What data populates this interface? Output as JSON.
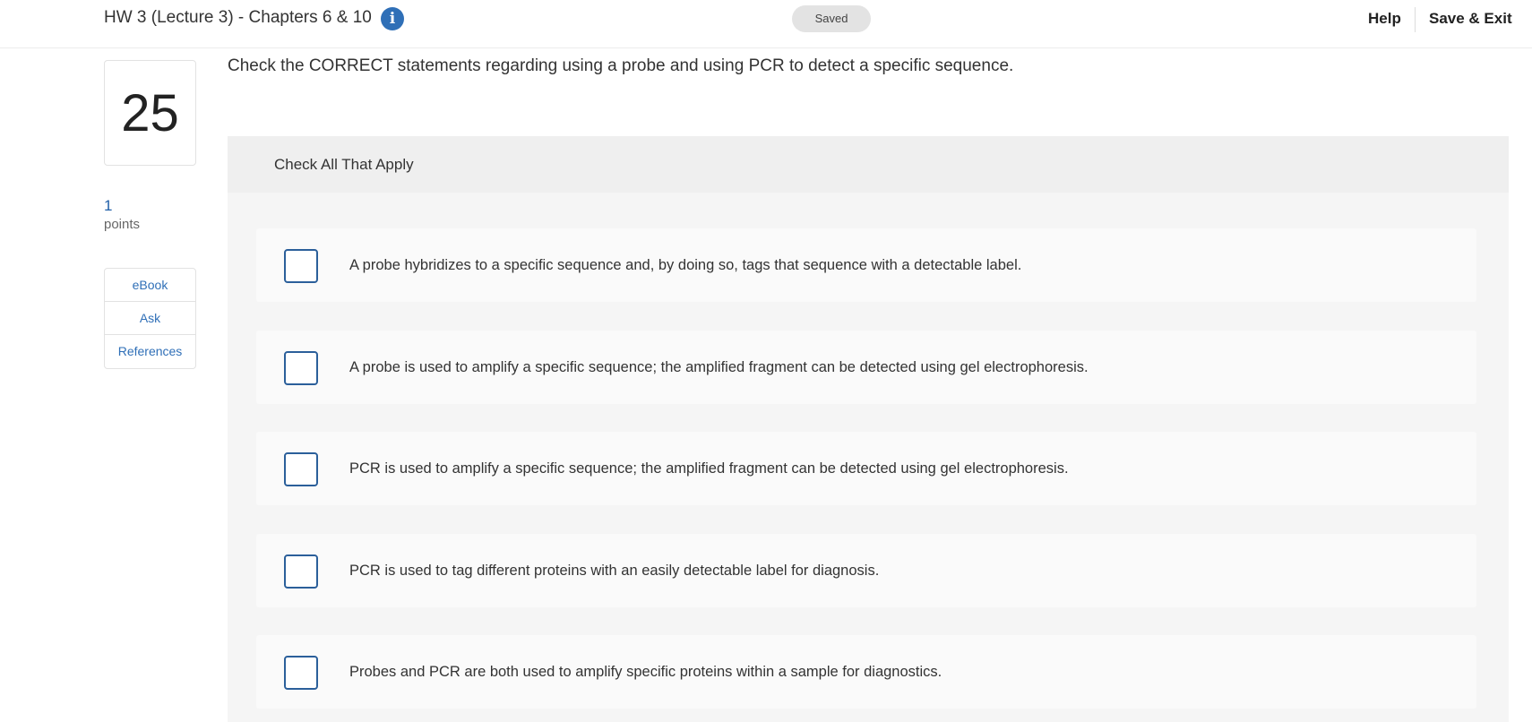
{
  "header": {
    "assignment_title": "HW 3 (Lecture 3) - Chapters 6 & 10",
    "info_glyph": "i",
    "save_status": "Saved",
    "help_label": "Help",
    "save_exit_label": "Save & Exit"
  },
  "sidebar": {
    "question_number": "25",
    "points_value": "1",
    "points_label": "points",
    "resources": [
      {
        "label": "eBook"
      },
      {
        "label": "Ask"
      },
      {
        "label": "References"
      }
    ]
  },
  "question": {
    "prompt": "Check the CORRECT statements regarding using a probe and using PCR to detect a specific sequence.",
    "instruction": "Check All That Apply",
    "choices": [
      {
        "text": "A probe hybridizes to a specific sequence and, by doing so, tags that sequence with a detectable label.",
        "checked": false
      },
      {
        "text": "A probe is used to amplify a specific sequence; the amplified fragment can be detected using gel electrophoresis.",
        "checked": false
      },
      {
        "text": "PCR is used to amplify a specific sequence; the amplified fragment can be detected using gel electrophoresis.",
        "checked": false
      },
      {
        "text": "PCR is used to tag different proteins with an easily detectable label for diagnosis.",
        "checked": false
      },
      {
        "text": "Probes and PCR are both used to amplify specific proteins within a sample for diagnostics.",
        "checked": false
      }
    ]
  },
  "colors": {
    "accent": "#2f6fb7",
    "checkbox_border": "#2b5f9a",
    "panel_bg": "#f5f5f5",
    "choice_bg": "#fafafa"
  }
}
